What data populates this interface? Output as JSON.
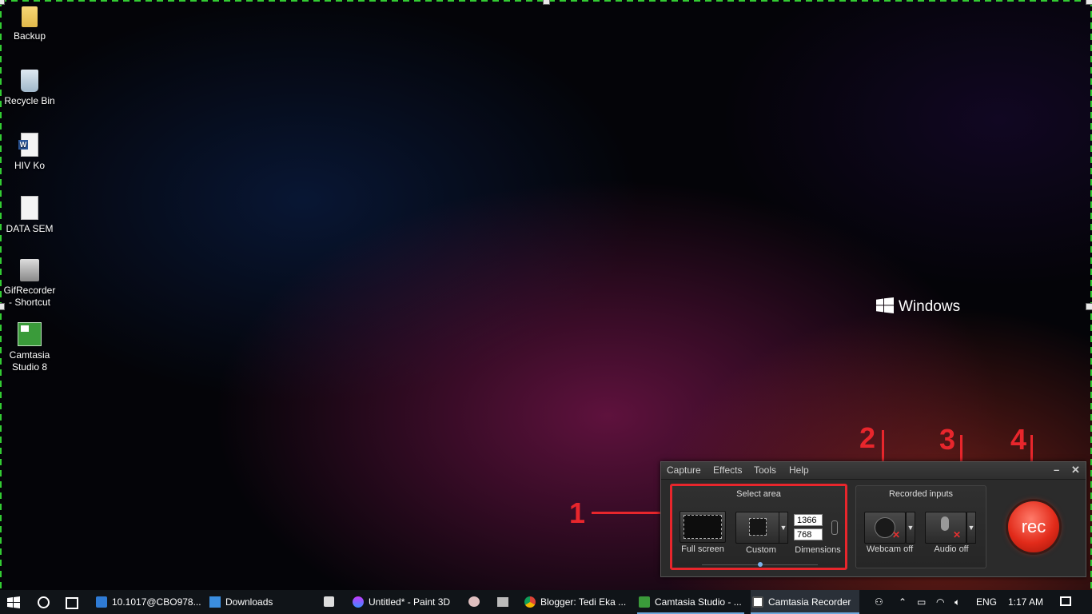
{
  "desktop": {
    "icons": [
      {
        "label": "Backup",
        "icon": "folder-icon"
      },
      {
        "label": "Recycle Bin",
        "icon": "recycle-bin-icon"
      },
      {
        "label": "HIV Ko",
        "icon": "word-document-icon"
      },
      {
        "label": "DATA SEM",
        "icon": "text-document-icon"
      },
      {
        "label": "GifRecorder - Shortcut",
        "icon": "gifrecorder-icon"
      },
      {
        "label": "Camtasia Studio 8",
        "icon": "camtasia-icon"
      }
    ],
    "windows_brand": "Windows"
  },
  "annotations": {
    "n1": "1",
    "n2": "2",
    "n3": "3",
    "n4": "4",
    "color": "#e8262c"
  },
  "recorder": {
    "menu": [
      "Capture",
      "Effects",
      "Tools",
      "Help"
    ],
    "minimize": "–",
    "close": "✕",
    "select_area": {
      "title": "Select area",
      "full_screen": "Full screen",
      "custom": "Custom",
      "dimensions_label": "Dimensions",
      "width": "1366",
      "height": "768"
    },
    "recorded_inputs": {
      "title": "Recorded inputs",
      "webcam": "Webcam off",
      "audio": "Audio off"
    },
    "rec_label": "rec"
  },
  "taskbar": {
    "apps": [
      {
        "label": "10.1017@CBO978...",
        "icon": "edge-icon"
      },
      {
        "label": "Downloads",
        "icon": "download-icon"
      },
      {
        "label": "Untitled* - Paint 3D",
        "icon": "paint3d-icon"
      },
      {
        "label": "Blogger: Tedi Eka ...",
        "icon": "chrome-icon"
      },
      {
        "label": "Camtasia Studio - ...",
        "icon": "camtasia-icon"
      },
      {
        "label": "Camtasia Recorder",
        "icon": "camtasia-recorder-icon"
      }
    ],
    "language": "ENG",
    "time": "1:17 AM"
  }
}
